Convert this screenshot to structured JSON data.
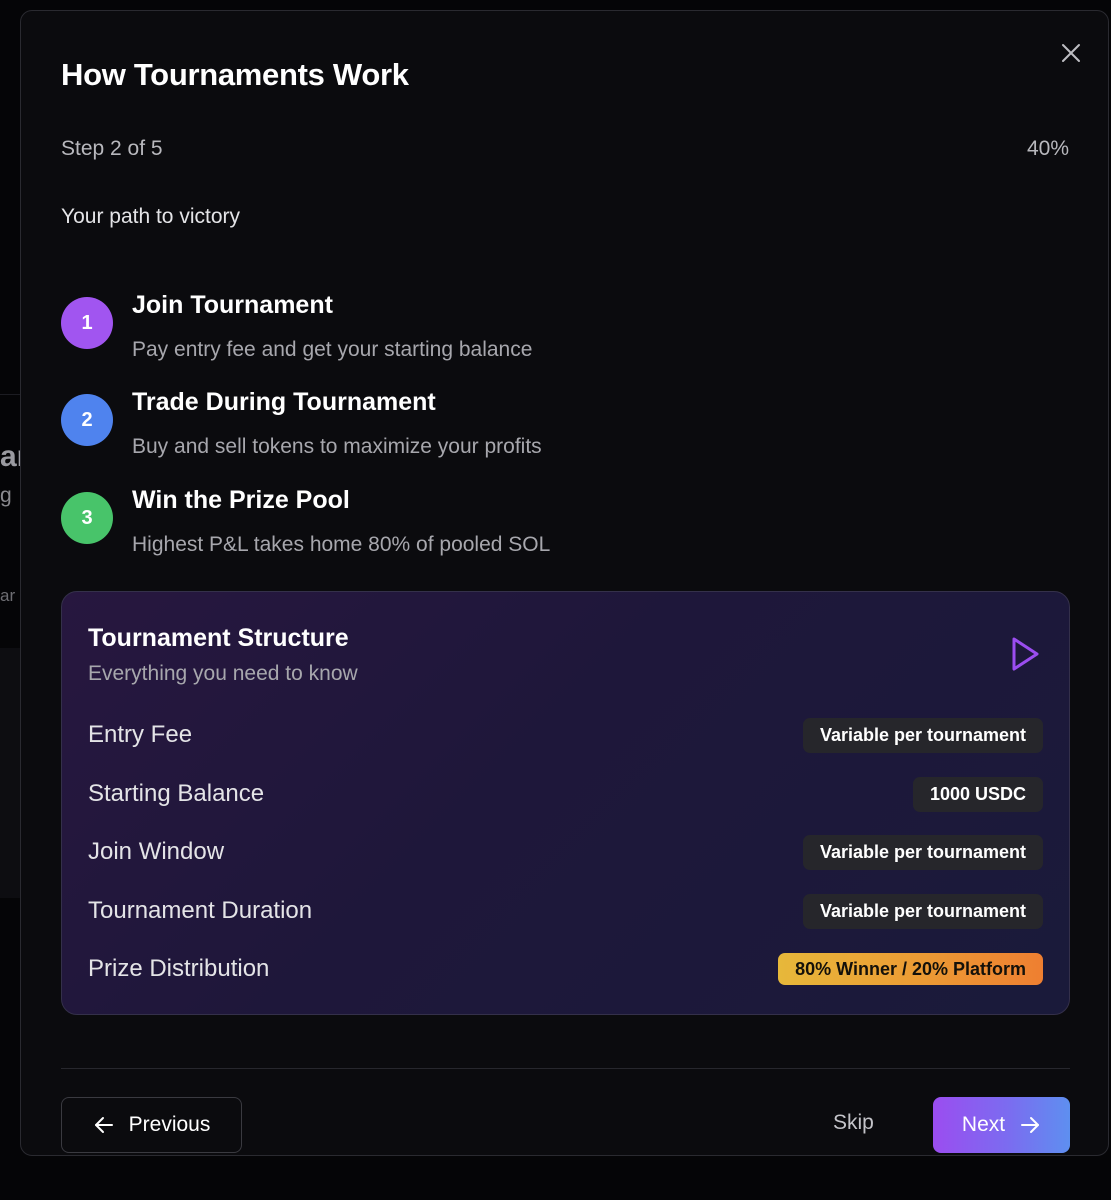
{
  "background": {
    "fragment_1": "ar",
    "fragment_2": "g",
    "fragment_3": "ar"
  },
  "modal": {
    "title": "How Tournaments Work",
    "close_icon": "close-icon",
    "progress": {
      "step_text": "Step 2 of 5",
      "percent_text": "40%",
      "current_step": 2,
      "total_steps": 5
    },
    "subtitle": "Your path to victory",
    "steps": [
      {
        "number": "1",
        "title": "Join Tournament",
        "description": "Pay entry fee and get your starting balance",
        "color": "#a155f0"
      },
      {
        "number": "2",
        "title": "Trade During Tournament",
        "description": "Buy and sell tokens to maximize your profits",
        "color": "#4f83ee"
      },
      {
        "number": "3",
        "title": "Win the Prize Pool",
        "description": "Highest P&L takes home 80% of pooled SOL",
        "color": "#48c46a"
      }
    ],
    "structure_card": {
      "title": "Tournament Structure",
      "subtitle": "Everything you need to know",
      "icon": "play-icon",
      "rows": [
        {
          "label": "Entry Fee",
          "value": "Variable per tournament"
        },
        {
          "label": "Starting Balance",
          "value": "1000 USDC"
        },
        {
          "label": "Join Window",
          "value": "Variable per tournament"
        },
        {
          "label": "Tournament Duration",
          "value": "Variable per tournament"
        },
        {
          "label": "Prize Distribution",
          "value": "80% Winner / 20% Platform"
        }
      ]
    },
    "footer": {
      "previous_label": "Previous",
      "skip_label": "Skip",
      "next_label": "Next"
    }
  },
  "colors": {
    "accent_purple": "#9b4df0",
    "accent_blue": "#5e8ff0",
    "prize_badge": "#ec9a34",
    "card_background": "#1e173a"
  }
}
